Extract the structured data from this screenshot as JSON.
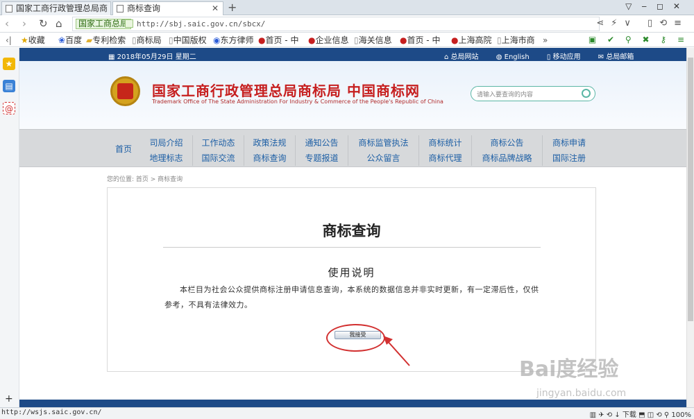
{
  "browser": {
    "tabs": [
      {
        "title": "国家工商行政管理总局商",
        "active": false
      },
      {
        "title": "商标查询",
        "active": true
      }
    ],
    "new_tab": "+",
    "site_label": "国家工商总局",
    "url": "http://sbj.saic.gov.cn/sbcx/",
    "bookmarks": [
      "收藏",
      "百度",
      "专利检索",
      "商标局",
      "中国版权",
      "东方律师",
      "首页 - 中",
      "企业信息",
      "海关信息",
      "首页 - 中",
      "上海高院",
      "上海市商"
    ],
    "more_bookmarks": "»",
    "status_url": "http://wsjs.saic.gov.cn/",
    "download_label": "下载",
    "zoom": "100%"
  },
  "site": {
    "date": "2018年05月29日 星期二",
    "top_links": [
      "总局网站",
      "English",
      "移动应用",
      "总局邮箱"
    ],
    "title_cn": "国家工商行政管理总局商标局 中国商标网",
    "title_en": "Trademark Office of The State Administration For Industry & Commerce of the People's Republic of China",
    "search_placeholder": "请输入要查询的内容",
    "menu": {
      "home": "首页",
      "columns": [
        [
          "司局介绍",
          "地理标志"
        ],
        [
          "工作动态",
          "国际交流"
        ],
        [
          "政策法规",
          "商标查询"
        ],
        [
          "通知公告",
          "专题报道"
        ],
        [
          "商标监管执法",
          "公众留言"
        ],
        [
          "商标统计",
          "商标代理"
        ],
        [
          "商标公告",
          "商标品牌战略"
        ],
        [
          "商标申请",
          "国际注册"
        ]
      ]
    },
    "breadcrumb": "您的位置: 首页 > 商标查询",
    "page_title": "商标查询",
    "section_title": "使用说明",
    "description": "本栏目为社会公众提供商标注册申请信息查询，本系统的数据信息并非实时更新，有一定滞后性，仅供参考，不具有法律效力。",
    "agree_button": "我接受"
  },
  "watermark": {
    "text": "Bai度经验",
    "url": "jingyan.baidu.com"
  },
  "colors": {
    "nav_blue": "#1d4a87",
    "title_red": "#c61f1f",
    "annotation_red": "#d23030",
    "menu_link": "#1d5fa5"
  }
}
